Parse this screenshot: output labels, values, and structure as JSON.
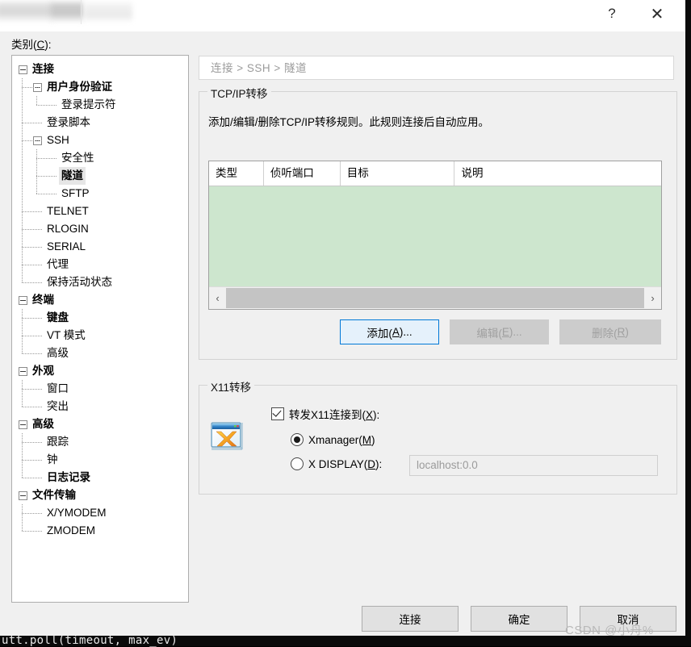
{
  "window": {
    "help_label": "?",
    "close_label": "✕"
  },
  "category": {
    "label_prefix": "类别(",
    "label_key": "C",
    "label_suffix": "):"
  },
  "tree": {
    "items": [
      {
        "label": "连接",
        "depth": 0,
        "bold": true,
        "selected": false,
        "expander": true
      },
      {
        "label": "用户身份验证",
        "depth": 1,
        "bold": true,
        "selected": false,
        "expander": true
      },
      {
        "label": "登录提示符",
        "depth": 2,
        "bold": false,
        "selected": false,
        "expander": false
      },
      {
        "label": "登录脚本",
        "depth": 1,
        "bold": false,
        "selected": false,
        "expander": false
      },
      {
        "label": "SSH",
        "depth": 1,
        "bold": false,
        "selected": false,
        "expander": true
      },
      {
        "label": "安全性",
        "depth": 2,
        "bold": false,
        "selected": false,
        "expander": false
      },
      {
        "label": "隧道",
        "depth": 2,
        "bold": true,
        "selected": true,
        "expander": false
      },
      {
        "label": "SFTP",
        "depth": 2,
        "bold": false,
        "selected": false,
        "expander": false
      },
      {
        "label": "TELNET",
        "depth": 1,
        "bold": false,
        "selected": false,
        "expander": false
      },
      {
        "label": "RLOGIN",
        "depth": 1,
        "bold": false,
        "selected": false,
        "expander": false
      },
      {
        "label": "SERIAL",
        "depth": 1,
        "bold": false,
        "selected": false,
        "expander": false
      },
      {
        "label": "代理",
        "depth": 1,
        "bold": false,
        "selected": false,
        "expander": false
      },
      {
        "label": "保持活动状态",
        "depth": 1,
        "bold": false,
        "selected": false,
        "expander": false
      },
      {
        "label": "终端",
        "depth": 0,
        "bold": true,
        "selected": false,
        "expander": true
      },
      {
        "label": "键盘",
        "depth": 1,
        "bold": true,
        "selected": false,
        "expander": false
      },
      {
        "label": "VT 模式",
        "depth": 1,
        "bold": false,
        "selected": false,
        "expander": false
      },
      {
        "label": "高级",
        "depth": 1,
        "bold": false,
        "selected": false,
        "expander": false
      },
      {
        "label": "外观",
        "depth": 0,
        "bold": true,
        "selected": false,
        "expander": true
      },
      {
        "label": "窗口",
        "depth": 1,
        "bold": false,
        "selected": false,
        "expander": false
      },
      {
        "label": "突出",
        "depth": 1,
        "bold": false,
        "selected": false,
        "expander": false
      },
      {
        "label": "高级",
        "depth": 0,
        "bold": true,
        "selected": false,
        "expander": true
      },
      {
        "label": "跟踪",
        "depth": 1,
        "bold": false,
        "selected": false,
        "expander": false
      },
      {
        "label": "钟",
        "depth": 1,
        "bold": false,
        "selected": false,
        "expander": false
      },
      {
        "label": "日志记录",
        "depth": 1,
        "bold": true,
        "selected": false,
        "expander": false
      },
      {
        "label": "文件传输",
        "depth": 0,
        "bold": true,
        "selected": false,
        "expander": true
      },
      {
        "label": "X/YMODEM",
        "depth": 1,
        "bold": false,
        "selected": false,
        "expander": false
      },
      {
        "label": "ZMODEM",
        "depth": 1,
        "bold": false,
        "selected": false,
        "expander": false
      }
    ]
  },
  "breadcrumb": {
    "text": "连接 > SSH > 隧道"
  },
  "tcp_group": {
    "title": "TCP/IP转移",
    "description": "添加/编辑/删除TCP/IP转移规则。此规则连接后自动应用。",
    "table": {
      "columns": [
        "类型",
        "侦听端口",
        "目标",
        "说明"
      ],
      "rows": [],
      "empty_bg_color": "#cde6ce"
    },
    "scrollbar": {
      "left_arrow": "‹",
      "right_arrow": "›"
    },
    "buttons": {
      "add": {
        "prefix": "添加(",
        "key": "A",
        "suffix": ")...",
        "state": "focused"
      },
      "edit": {
        "prefix": "编辑(",
        "key": "E",
        "suffix": ")...",
        "state": "disabled"
      },
      "delete": {
        "prefix": "删除(",
        "key": "R",
        "suffix": ")",
        "state": "disabled"
      }
    }
  },
  "x11_group": {
    "title": "X11转移",
    "icon": "xmanager-app-icon",
    "checkbox": {
      "prefix": "转发X11连接到(",
      "key": "X",
      "suffix": "):",
      "checked": true
    },
    "radio_xmanager": {
      "prefix": "Xmanager(",
      "key": "M",
      "suffix": ")",
      "selected": true
    },
    "radio_xdisplay": {
      "prefix": "X DISPLAY(",
      "key": "D",
      "suffix": "):",
      "selected": false
    },
    "xdisplay_input": {
      "value": "",
      "placeholder": "localhost:0.0",
      "disabled": true
    }
  },
  "footer": {
    "connect": "连接",
    "ok": "确定",
    "cancel": "取消"
  },
  "watermark": {
    "text": "CSDN @小舟%"
  },
  "background_terminal": {
    "visible_line": "utt.poll(timeout, max_ev)"
  },
  "colors": {
    "accent_blue": "#0078d7",
    "list_empty_green": "#cde6ce",
    "dialog_bg": "#f0f0f0",
    "disabled_gray": "#cccccc"
  }
}
